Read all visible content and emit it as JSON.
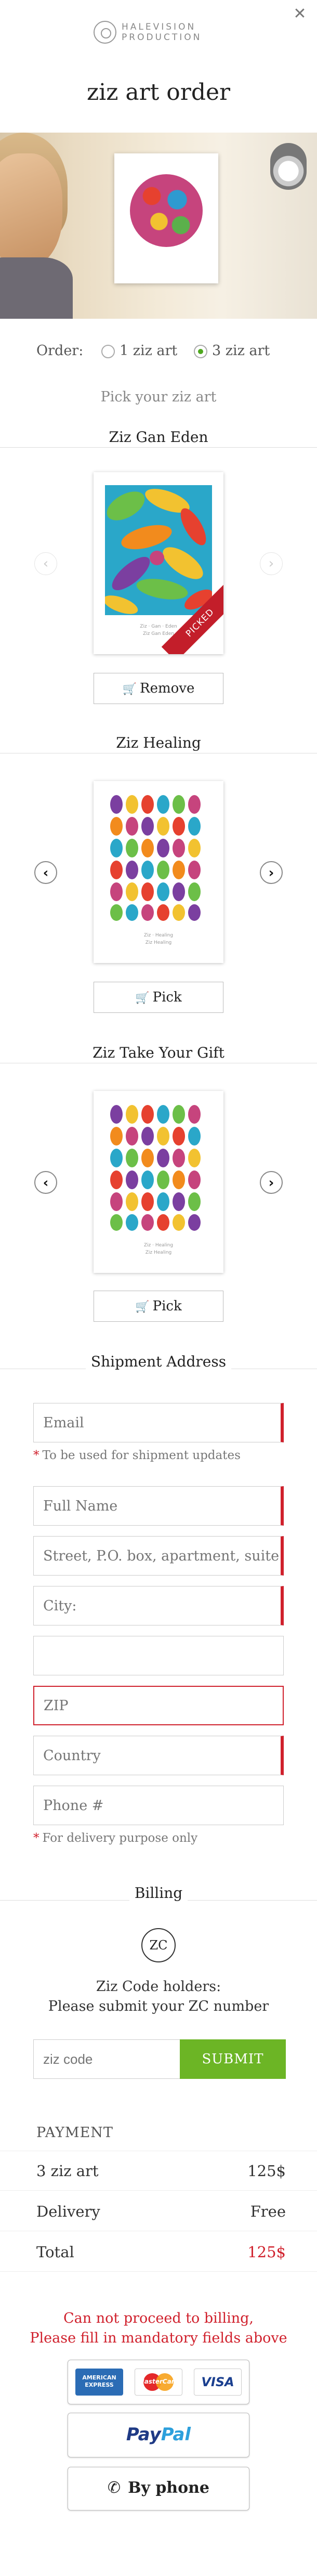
{
  "header": {
    "close_icon": "close-icon",
    "logo_line1": "HALEVISION",
    "logo_line2": "PRODUCTION",
    "title": "ziz art order"
  },
  "order": {
    "label": "Order:",
    "options": [
      {
        "label": "1 ziz art",
        "selected": false
      },
      {
        "label": "3 ziz art",
        "selected": true
      }
    ],
    "accent_color": "#4ea81e"
  },
  "pick_prompt": "Pick your ziz art",
  "artworks": [
    {
      "title": "Ziz Gan Eden",
      "caption_line1": "Ziz  ·  Gan  ·  Eden",
      "caption_line2": "Ziz Gan Eden",
      "ribbon": "PICKED",
      "button_label": "Remove",
      "picked": true
    },
    {
      "title": "Ziz Healing",
      "caption_line1": "Ziz  ·  Healing",
      "caption_line2": "Ziz Healing",
      "ribbon": "",
      "button_label": "Pick",
      "picked": false
    },
    {
      "title": "Ziz Take Your Gift",
      "caption_line1": "Ziz  ·  Healing",
      "caption_line2": "Ziz Healing",
      "ribbon": "",
      "button_label": "Pick",
      "picked": false
    }
  ],
  "shipment": {
    "title": "Shipment Address",
    "email_placeholder": "Email",
    "email_note": "To be used for shipment updates",
    "fullname_placeholder": "Full Name",
    "street_placeholder": "Street, P.O. box, apartment, suite",
    "city_placeholder": "City:",
    "extra_value": "",
    "zip_placeholder": "ZIP",
    "country_placeholder": "Country",
    "phone_placeholder": "Phone #",
    "phone_note": "For delivery purpose only"
  },
  "billing": {
    "title": "Billing",
    "zc_badge": "ZC",
    "zc_line1": "Ziz Code holders:",
    "zc_line2": "Please submit your ZC number",
    "zc_placeholder": "ziz code",
    "submit_label": "SUBMIT",
    "submit_color": "#6cb525"
  },
  "payment": {
    "heading": "PAYMENT",
    "rows": [
      {
        "label": "3 ziz art",
        "value": "125$"
      },
      {
        "label": "Delivery",
        "value": "Free"
      },
      {
        "label": "Total",
        "value": "125$"
      }
    ],
    "error_line1": "Can not proceed to billing,",
    "error_line2": "Please fill in mandatory fields above",
    "error_color": "#d0202c",
    "cards": {
      "amex": "AMERICAN EXPRESS",
      "mastercard": "MasterCard",
      "visa": "VISA"
    },
    "paypal_1": "Pay",
    "paypal_2": "Pal",
    "by_phone": "By phone"
  }
}
